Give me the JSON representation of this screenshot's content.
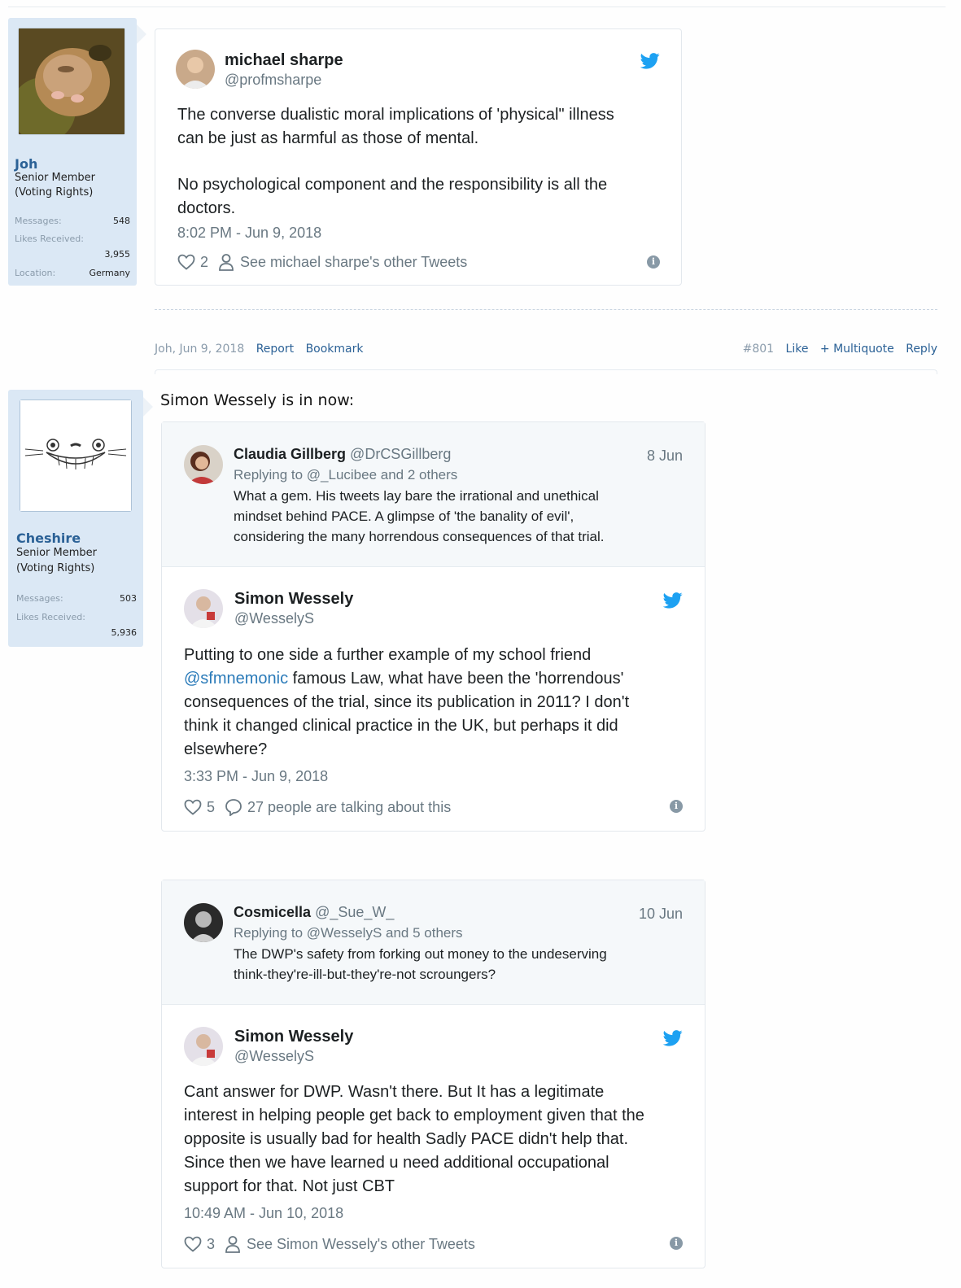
{
  "post1": {
    "member": {
      "username": "Joh",
      "title": "Senior Member",
      "rights": "(Voting Rights)",
      "messages_label": "Messages:",
      "messages": "548",
      "likes_label": "Likes Received:",
      "likes": "3,955",
      "location_label": "Location:",
      "location": "Germany"
    },
    "tweet": {
      "name": "michael sharpe",
      "handle": "@profmsharpe",
      "text1": "The converse dualistic moral implications of 'physical\" illness",
      "text2": "can be just as harmful as those of mental.",
      "text3": "No psychological component and the responsibility is all the",
      "text4": "doctors.",
      "time": "8:02 PM - Jun 9, 2018",
      "likes": "2",
      "other_tweets": "See michael sharpe's other Tweets"
    }
  },
  "footer": {
    "meta": "Joh, Jun 9, 2018",
    "report": "Report",
    "bookmark": "Bookmark",
    "number": "#801",
    "like": "Like",
    "multiquote": "+ Multiquote",
    "reply": "Reply"
  },
  "post2": {
    "member": {
      "username": "Cheshire",
      "title": "Senior Member",
      "rights": "(Voting Rights)",
      "messages_label": "Messages:",
      "messages": "503",
      "likes_label": "Likes Received:",
      "likes": "5,936"
    },
    "intro": "Simon Wessely is in now:",
    "tweet1": {
      "reply_name": "Claudia Gillberg",
      "reply_handle": "@DrCSGillberg",
      "reply_date": "8 Jun",
      "replying_to": "Replying to @_Lucibee and 2 others",
      "reply_text1": "What a gem. His tweets lay bare the irrational and unethical",
      "reply_text2": "mindset behind PACE. A glimpse of 'the banality of evil',",
      "reply_text3": "considering the many horrendous consequences of that trial.",
      "name": "Simon Wessely",
      "handle": "@WesselyS",
      "text1": "Putting to one side a further example of my school friend",
      "mention": "@sfmnemonic",
      "text2": " famous Law, what have been the 'horrendous'",
      "text3": "consequences of the trial, since its publication in 2011? I don't",
      "text4": "think it changed clinical practice in the UK, but perhaps it did",
      "text5": "elsewhere?",
      "time": "3:33 PM - Jun 9, 2018",
      "likes": "5",
      "talking": "27 people are talking about this"
    },
    "tweet2": {
      "reply_name": "Cosmicella",
      "reply_handle": "@_Sue_W_",
      "reply_date": "10 Jun",
      "replying_to": "Replying to @WesselyS and 5 others",
      "reply_text1": "The DWP's safety from forking out money to the undeserving",
      "reply_text2": "think-they're-ill-but-they're-not scroungers?",
      "name": "Simon Wessely",
      "handle": "@WesselyS",
      "text1": "Cant answer for DWP. Wasn't there. But It has a legitimate",
      "text2": "interest in helping people get back to employment given that the",
      "text3": "opposite is usually bad for health  Sadly PACE didn't help that.",
      "text4": "Since then we have learned u need additional occupational",
      "text5": "support for that. Not just CBT",
      "time": "10:49 AM - Jun 10, 2018",
      "likes": "3",
      "other_tweets": "See Simon Wessely's other Tweets"
    }
  },
  "colors": {
    "accent_link": "#2b6196",
    "twitter_blue": "#1da1f2",
    "sidebar_bg": "#dbe8f5",
    "muted": "#697882"
  },
  "icons": [
    "twitter-bird-icon",
    "heart-icon",
    "person-icon",
    "info-icon",
    "comment-icon"
  ]
}
